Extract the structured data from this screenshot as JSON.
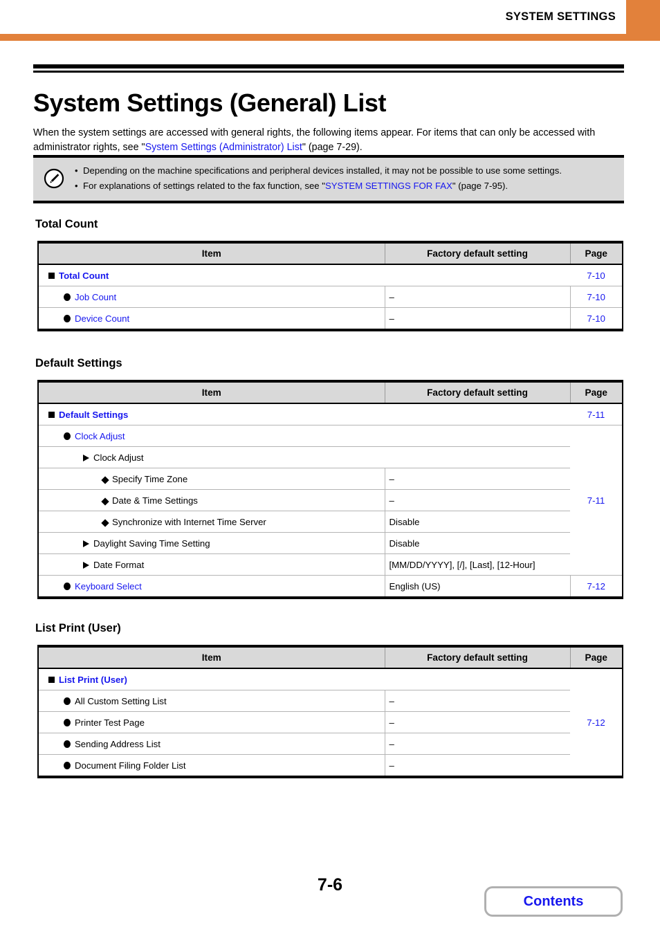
{
  "header": {
    "title": "SYSTEM SETTINGS",
    "accent_color": "#e2813b"
  },
  "page_title": "System Settings (General) List",
  "intro": {
    "part1": "When the system settings are accessed with general rights, the following items appear. For items that can only be accessed with administrator rights, see \"",
    "link": "System Settings (Administrator) List",
    "part2": "\" (page 7-29)."
  },
  "note": {
    "icon": "pencil-note-icon",
    "bullet_glyph": "•",
    "items": [
      {
        "part1": "Depending on the machine specifications and peripheral devices installed, it may not be possible to use some settings.",
        "link": "",
        "part2": ""
      },
      {
        "part1": "For explanations of settings related to the fax function, see \"",
        "link": "SYSTEM SETTINGS FOR FAX",
        "part2": "\" (page 7-95)."
      }
    ]
  },
  "columns": {
    "item": "Item",
    "factory": "Factory default setting",
    "page": "Page"
  },
  "sections": [
    {
      "heading": "Total Count",
      "rows": [
        {
          "level": 1,
          "label": "Total Count",
          "link": true,
          "bold": true,
          "span": true,
          "factory": "",
          "page": "7-10",
          "page_rowspan": 1
        },
        {
          "level": 2,
          "label": "Job Count",
          "link": true,
          "bold": false,
          "span": false,
          "factory": "–",
          "page": "7-10",
          "page_rowspan": 1
        },
        {
          "level": 2,
          "label": "Device Count",
          "link": true,
          "bold": false,
          "span": false,
          "factory": "–",
          "page": "7-10",
          "page_rowspan": 1
        }
      ]
    },
    {
      "heading": "Default Settings",
      "rows": [
        {
          "level": 1,
          "label": "Default Settings",
          "link": true,
          "bold": true,
          "span": true,
          "factory": "",
          "page": "7-11",
          "page_rowspan": 1
        },
        {
          "level": 2,
          "label": "Clock Adjust",
          "link": true,
          "bold": false,
          "span": true,
          "factory": "",
          "page": "7-11",
          "page_rowspan": 7
        },
        {
          "level": 3,
          "label": "Clock Adjust",
          "link": false,
          "bold": false,
          "span": true,
          "factory": "",
          "page": null,
          "page_rowspan": 0
        },
        {
          "level": 4,
          "label": "Specify Time Zone",
          "link": false,
          "bold": false,
          "span": false,
          "factory": "–",
          "page": null,
          "page_rowspan": 0
        },
        {
          "level": 4,
          "label": "Date & Time Settings",
          "link": false,
          "bold": false,
          "span": false,
          "factory": "–",
          "page": null,
          "page_rowspan": 0
        },
        {
          "level": 4,
          "label": "Synchronize with Internet Time Server",
          "link": false,
          "bold": false,
          "span": false,
          "factory": "Disable",
          "page": null,
          "page_rowspan": 0
        },
        {
          "level": 3,
          "label": "Daylight Saving Time Setting",
          "link": false,
          "bold": false,
          "span": false,
          "factory": "Disable",
          "page": null,
          "page_rowspan": 0
        },
        {
          "level": 3,
          "label": "Date Format",
          "link": false,
          "bold": false,
          "span": false,
          "factory": "[MM/DD/YYYY], [/], [Last], [12-Hour]",
          "page": null,
          "page_rowspan": 0
        },
        {
          "level": 2,
          "label": "Keyboard Select",
          "link": true,
          "bold": false,
          "span": false,
          "factory": "English (US)",
          "page": "7-12",
          "page_rowspan": 1
        }
      ]
    },
    {
      "heading": "List Print (User)",
      "rows": [
        {
          "level": 1,
          "label": "List Print (User)",
          "link": true,
          "bold": true,
          "span": true,
          "factory": "",
          "page": "7-12",
          "page_rowspan": 5
        },
        {
          "level": 2,
          "label": "All Custom Setting List",
          "link": false,
          "bold": false,
          "span": false,
          "factory": "–",
          "page": null,
          "page_rowspan": 0
        },
        {
          "level": 2,
          "label": "Printer Test Page",
          "link": false,
          "bold": false,
          "span": false,
          "factory": "–",
          "page": null,
          "page_rowspan": 0
        },
        {
          "level": 2,
          "label": "Sending Address List",
          "link": false,
          "bold": false,
          "span": false,
          "factory": "–",
          "page": null,
          "page_rowspan": 0
        },
        {
          "level": 2,
          "label": "Document Filing Folder List",
          "link": false,
          "bold": false,
          "span": false,
          "factory": "–",
          "page": null,
          "page_rowspan": 0
        }
      ]
    }
  ],
  "footer": {
    "page_number": "7-6",
    "contents_label": "Contents"
  }
}
